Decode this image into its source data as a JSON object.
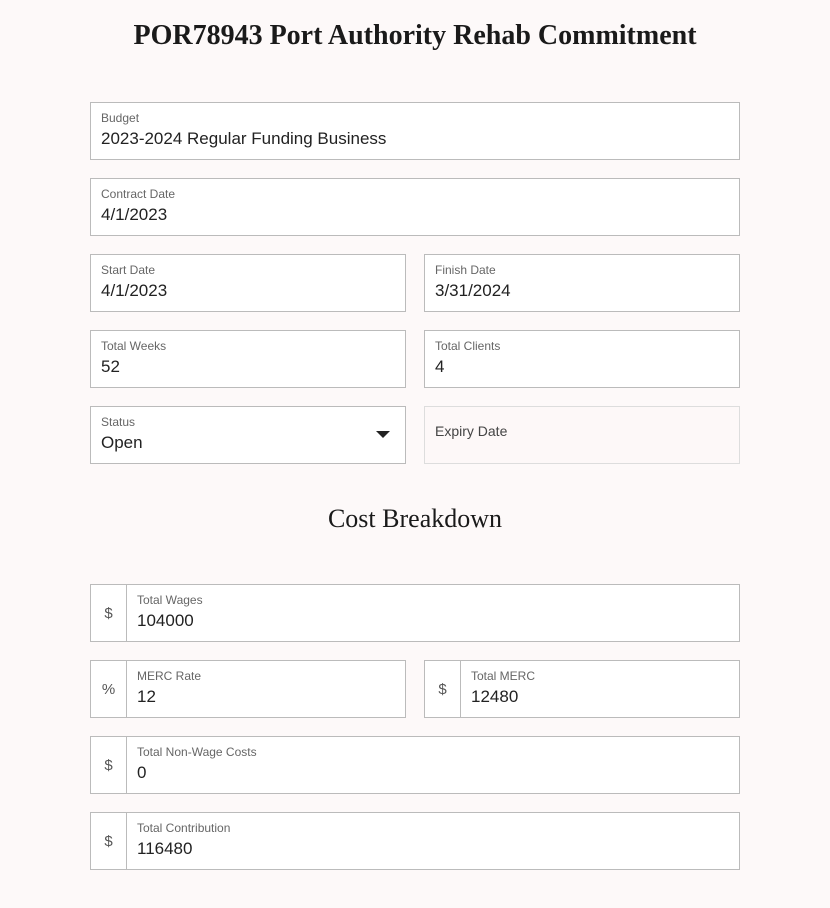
{
  "page_title": "POR78943 Port Authority Rehab Commitment",
  "section_title": "Cost Breakdown",
  "fields": {
    "budget": {
      "label": "Budget",
      "value": "2023-2024 Regular Funding Business"
    },
    "contract_date": {
      "label": "Contract Date",
      "value": "4/1/2023"
    },
    "start_date": {
      "label": "Start Date",
      "value": "4/1/2023"
    },
    "finish_date": {
      "label": "Finish Date",
      "value": "3/31/2024"
    },
    "total_weeks": {
      "label": "Total Weeks",
      "value": "52"
    },
    "total_clients": {
      "label": "Total Clients",
      "value": "4"
    },
    "status": {
      "label": "Status",
      "value": "Open"
    },
    "expiry_date": {
      "label": "Expiry Date",
      "value": ""
    },
    "total_wages": {
      "label": "Total Wages",
      "value": "104000",
      "prefix": "$"
    },
    "merc_rate": {
      "label": "MERC Rate",
      "value": "12",
      "prefix": "%"
    },
    "total_merc": {
      "label": "Total MERC",
      "value": "12480",
      "prefix": "$"
    },
    "total_non_wage": {
      "label": "Total Non-Wage Costs",
      "value": "0",
      "prefix": "$"
    },
    "total_contribution": {
      "label": "Total Contribution",
      "value": "116480",
      "prefix": "$"
    }
  }
}
